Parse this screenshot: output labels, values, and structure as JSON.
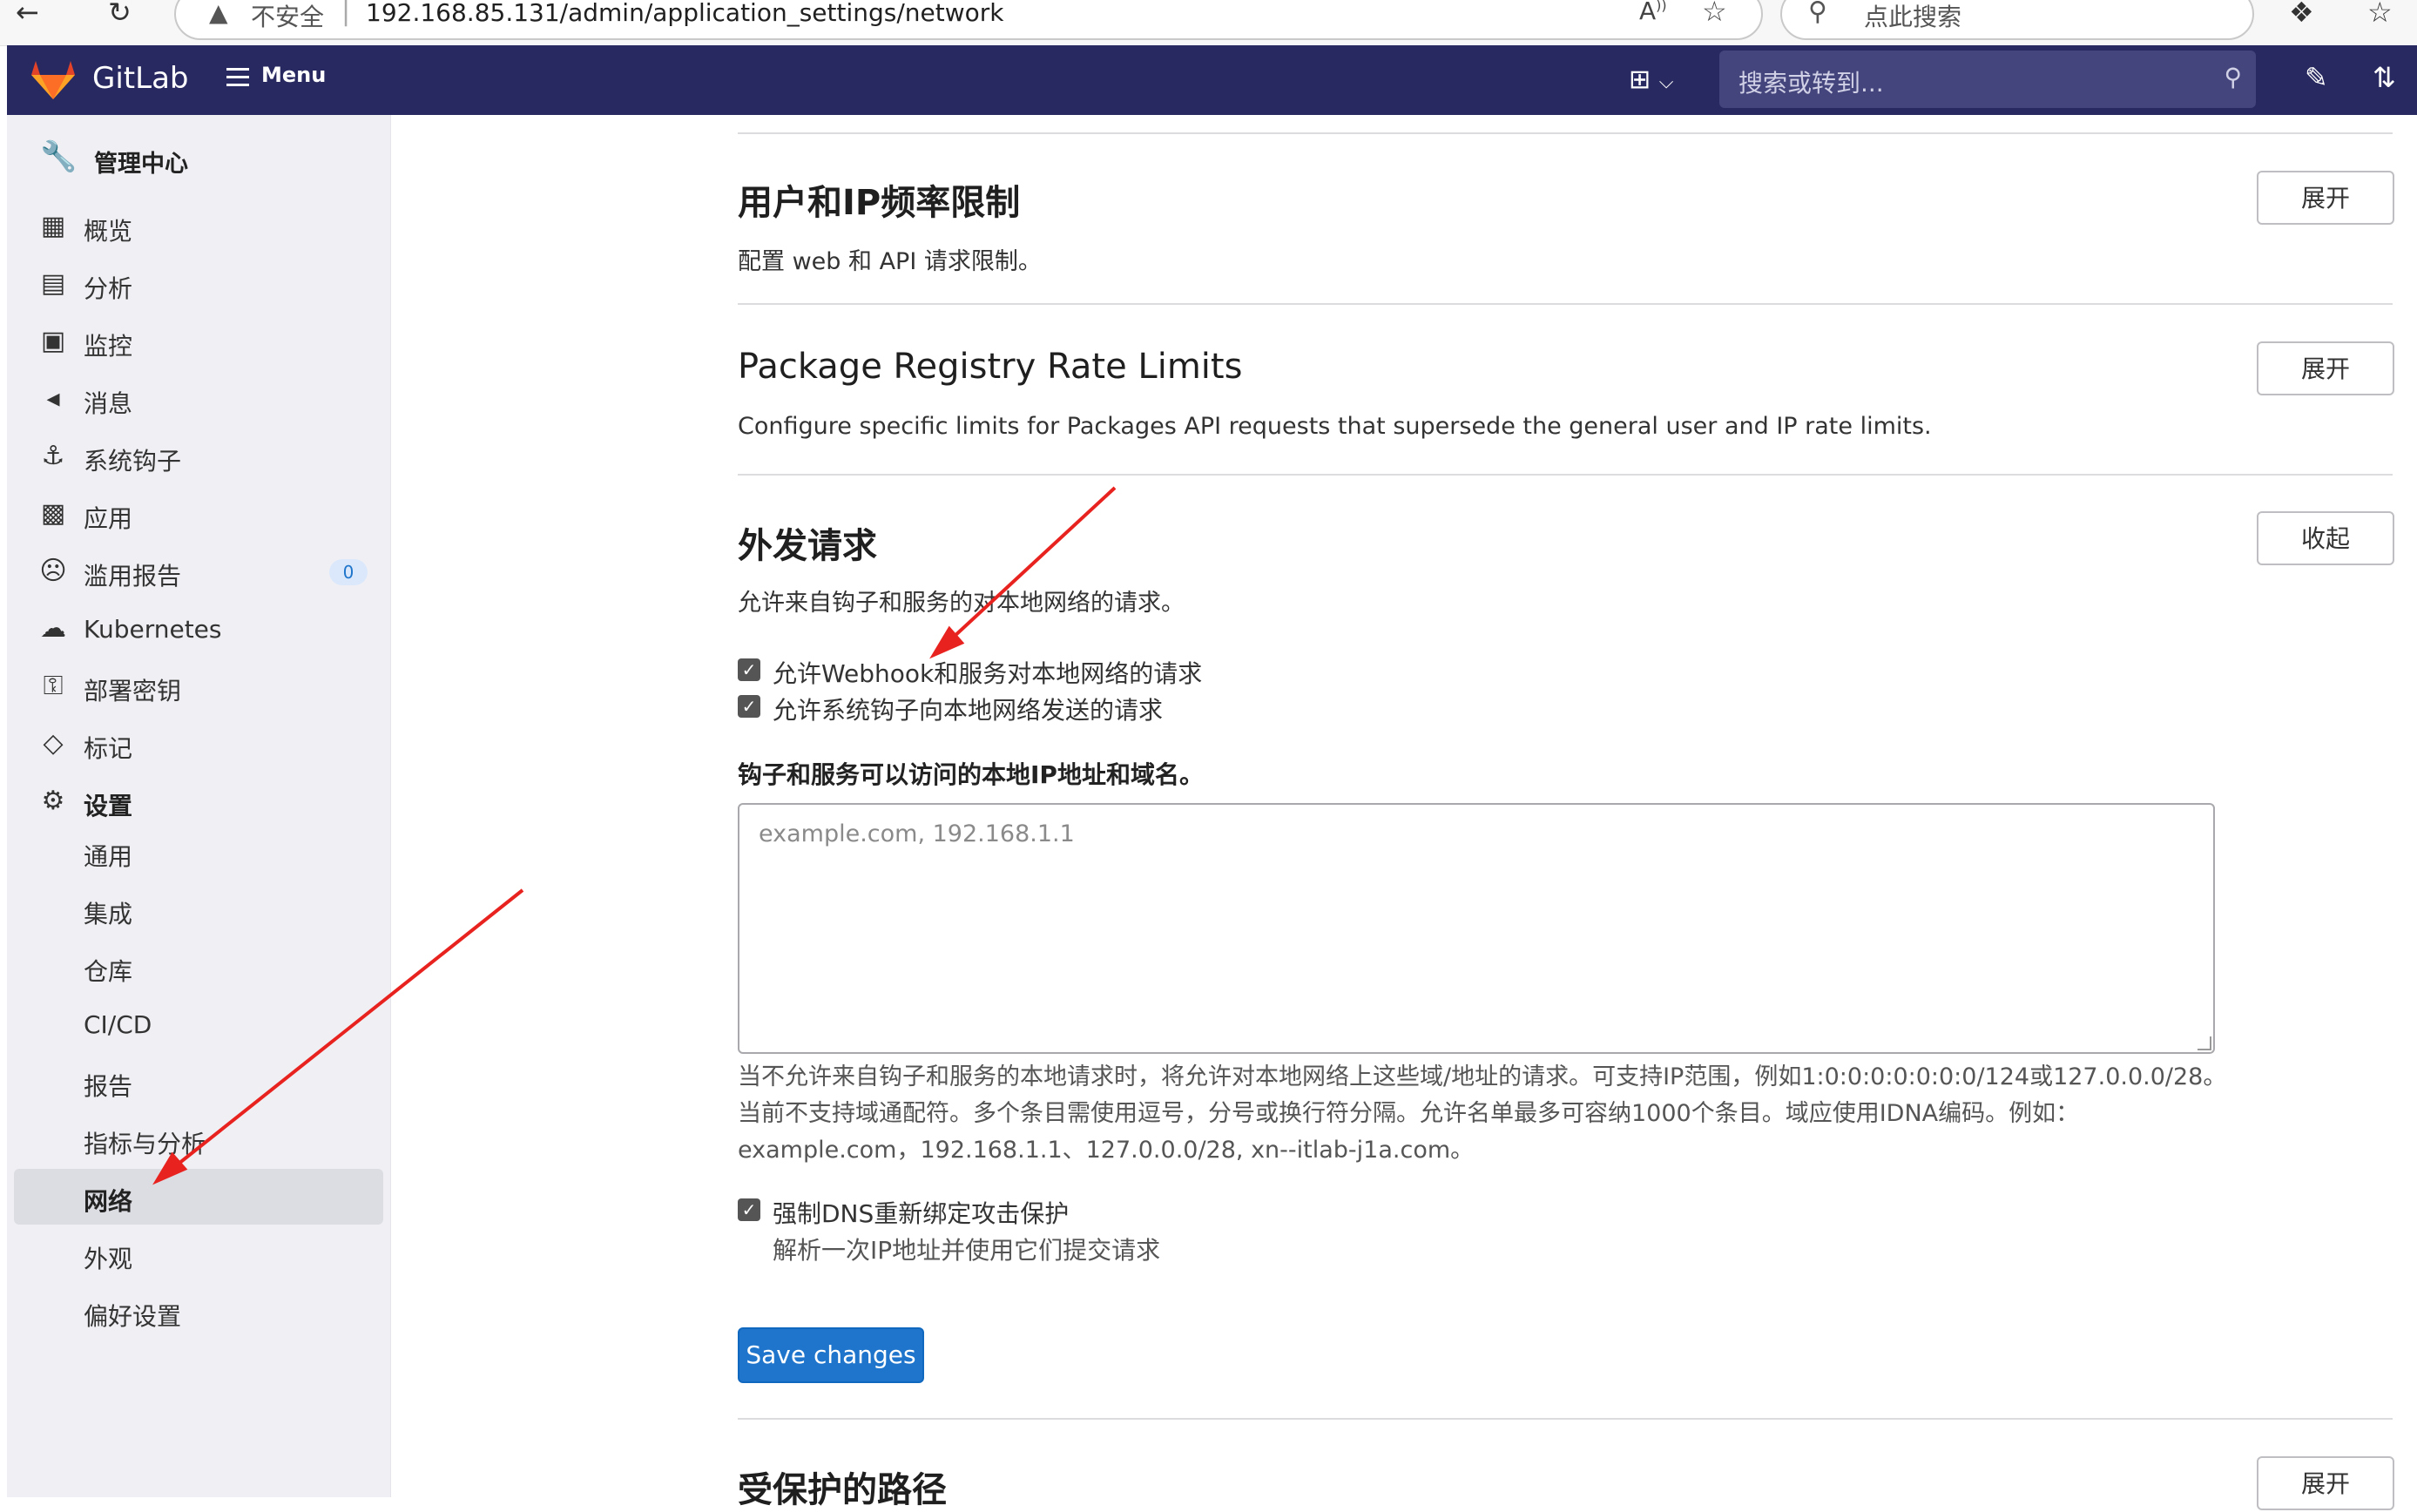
{
  "browser": {
    "security_label": "不安全",
    "url": "192.168.85.131/admin/application_settings/network",
    "search_placeholder": "点此搜索",
    "read_aloud": "A"
  },
  "topnav": {
    "brand": "GitLab",
    "menu_label": "Menu",
    "search_placeholder": "搜索或转到..."
  },
  "sidebar": {
    "title": "管理中心",
    "items": [
      {
        "label": "概览"
      },
      {
        "label": "分析"
      },
      {
        "label": "监控"
      },
      {
        "label": "消息"
      },
      {
        "label": "系统钩子"
      },
      {
        "label": "应用"
      },
      {
        "label": "滥用报告",
        "badge": "0"
      },
      {
        "label": "Kubernetes"
      },
      {
        "label": "部署密钥"
      },
      {
        "label": "标记"
      },
      {
        "label": "设置"
      }
    ],
    "settings_sub": [
      {
        "label": "通用"
      },
      {
        "label": "集成"
      },
      {
        "label": "仓库"
      },
      {
        "label": "CI/CD"
      },
      {
        "label": "报告"
      },
      {
        "label": "指标与分析"
      },
      {
        "label": "网络"
      },
      {
        "label": "外观"
      },
      {
        "label": "偏好设置"
      }
    ]
  },
  "sections": {
    "user_ip_limits": {
      "title": "用户和IP频率限制",
      "desc": "配置 web 和 API 请求限制。",
      "button": "展开"
    },
    "package_registry": {
      "title": "Package Registry Rate Limits",
      "desc": "Configure specific limits for Packages API requests that supersede the general user and IP rate limits.",
      "button": "展开"
    },
    "outbound": {
      "title": "外发请求",
      "desc": "允许来自钩子和服务的对本地网络的请求。",
      "button": "收起",
      "checkbox_webhook": "允许Webhook和服务对本地网络的请求",
      "checkbox_system_hooks": "允许系统钩子向本地网络发送的请求",
      "field_label": "钩子和服务可以访问的本地IP地址和域名。",
      "textarea_placeholder": "example.com, 192.168.1.1",
      "help_line1": "当不允许来自钩子和服务的本地请求时，将允许对本地网络上这些域/地址的请求。可支持IP范围，例如1:0:0:0:0:0:0:0/124或127.0.0.0/28。",
      "help_line2": "当前不支持域通配符。多个条目需使用逗号，分号或换行符分隔。允许名单最多可容纳1000个条目。域应使用IDNA编码。例如：",
      "help_line3": "example.com，192.168.1.1、127.0.0.0/28, xn--itlab-j1a.com。",
      "checkbox_dns": "强制DNS重新绑定攻击保护",
      "dns_help": "解析一次IP地址并使用它们提交请求",
      "save_button": "Save changes"
    },
    "protected_paths": {
      "title": "受保护的路径",
      "button": "展开"
    }
  },
  "colors": {
    "topnav": "#292961",
    "primary_button": "#1f75cb",
    "annotation_arrow": "#e8231f",
    "sidebar_bg": "#f0f0f4"
  },
  "icons": {
    "back": "arrow-left-icon",
    "reload": "reload-icon",
    "warning": "warning-triangle-icon",
    "favorite": "star-icon",
    "extensions": "puzzle-icon",
    "logo": "gitlab-tanuki-icon",
    "admin": "wrench-icon"
  }
}
